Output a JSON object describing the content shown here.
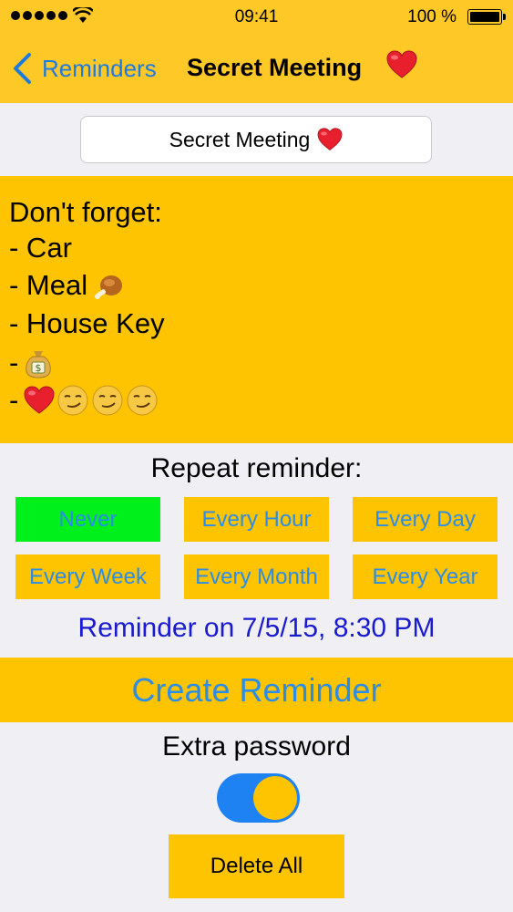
{
  "status": {
    "time": "09:41",
    "battery": "100 %"
  },
  "nav": {
    "back_label": "Reminders",
    "title": "Secret Meeting"
  },
  "title_field": {
    "value": "Secret Meeting"
  },
  "notes": {
    "lines": [
      "Don't forget:",
      "- Car",
      "- Meal",
      "- House Key",
      "-",
      "-"
    ]
  },
  "repeat": {
    "label": "Repeat reminder:",
    "options": [
      "Never",
      "Every Hour",
      "Every Day",
      "Every Week",
      "Every Month",
      "Every Year"
    ],
    "selected": "Never"
  },
  "reminder_date": "Reminder on 7/5/15, 8:30 PM",
  "create_button": "Create Reminder",
  "extra_password": {
    "label": "Extra password",
    "enabled": true
  },
  "delete_button": "Delete All",
  "colors": {
    "accent_yellow": "#fec301",
    "header_yellow": "#fec826",
    "link_blue": "#2b8de8",
    "selected_green": "#00f01c",
    "date_blue": "#1a1ad0"
  },
  "icons": [
    "heart-icon",
    "meat-icon",
    "money-bag-icon",
    "smirk-face-icon"
  ]
}
